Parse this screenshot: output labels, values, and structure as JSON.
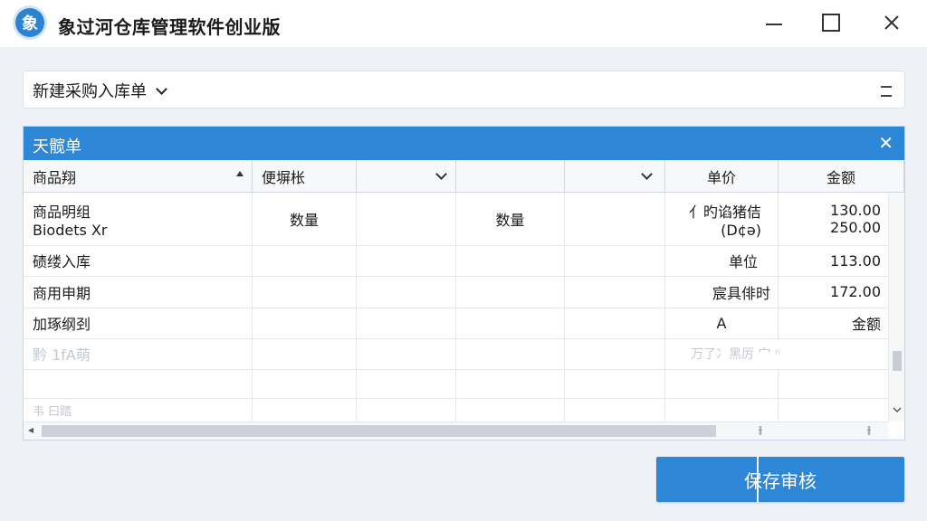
{
  "window": {
    "logo_glyph": "象",
    "title": "象过河仓库管理软件创业版"
  },
  "toolbar": {
    "doc_type_label": "新建采购入库单",
    "menu_icon": "hamburger-icon"
  },
  "panel": {
    "title": "天髋单",
    "close_glyph": "✕"
  },
  "table": {
    "headers": [
      "商品翔",
      "便塀枨",
      "",
      "",
      "",
      "单价",
      "金额"
    ],
    "rows": [
      {
        "c1": [
          "商品明组",
          "Biodets Xr"
        ],
        "c2": "数量",
        "c4": "数量",
        "c6": [
          "亻旳谄猪佶",
          "(D¢ə)"
        ],
        "c7": [
          "130.00",
          "250.00"
        ]
      },
      {
        "c1": [
          "碛缕入库"
        ],
        "c2": "",
        "c4": "",
        "c6": [
          "单位"
        ],
        "c7": [
          "113.00"
        ]
      },
      {
        "c1": [
          "商用申期"
        ],
        "c2": "",
        "c4": "",
        "c6": [
          "宸具俳时"
        ],
        "c7": [
          "172.00"
        ]
      },
      {
        "c1": [
          "加琢纲刭"
        ],
        "c2": "",
        "c4": "",
        "c6": [
          "A"
        ],
        "c7": [
          "金额"
        ]
      }
    ],
    "faded_rows": [
      {
        "c1": "黔  1fA萌",
        "c6": "万了冫黑厉  宀 ⁿ"
      },
      {
        "c1": "韦   曰踏"
      }
    ]
  },
  "buttons": {
    "save_audit": "保存审核"
  }
}
